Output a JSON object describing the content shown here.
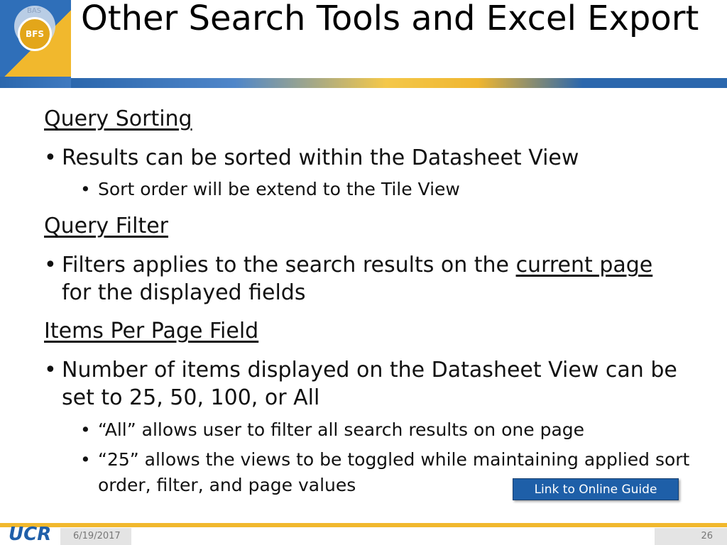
{
  "logo": {
    "small_text": "BAS",
    "badge_text": "BFS"
  },
  "title": "Other Search Tools and Excel Export",
  "sections": [
    {
      "heading": "Query Sorting",
      "bullets": [
        {
          "text": "Results can be sorted within the Datasheet View",
          "sub": [
            "Sort order will be extend to the Tile View"
          ]
        }
      ]
    },
    {
      "heading": "Query Filter",
      "bullets": [
        {
          "text_before": "Filters applies to the search results on the ",
          "text_underlined": "current page",
          "text_after": "for the displayed fields"
        }
      ]
    },
    {
      "heading": "Items Per Page Field ",
      "bullets": [
        {
          "text": "Number of items displayed on the Datasheet View can be set to 25, 50, 100, or All",
          "sub": [
            "“All” allows user to filter all search results on one page",
            "“25” allows the views to be toggled while maintaining applied sort order, filter, and page values"
          ]
        }
      ]
    }
  ],
  "link_button": "Link to Online Guide",
  "footer": {
    "logo_text": "UCR",
    "date": "6/19/2017",
    "page": "26"
  },
  "colors": {
    "brand_blue": "#2b67ad",
    "brand_gold": "#f1b82d",
    "button_blue": "#1e5fa8"
  }
}
